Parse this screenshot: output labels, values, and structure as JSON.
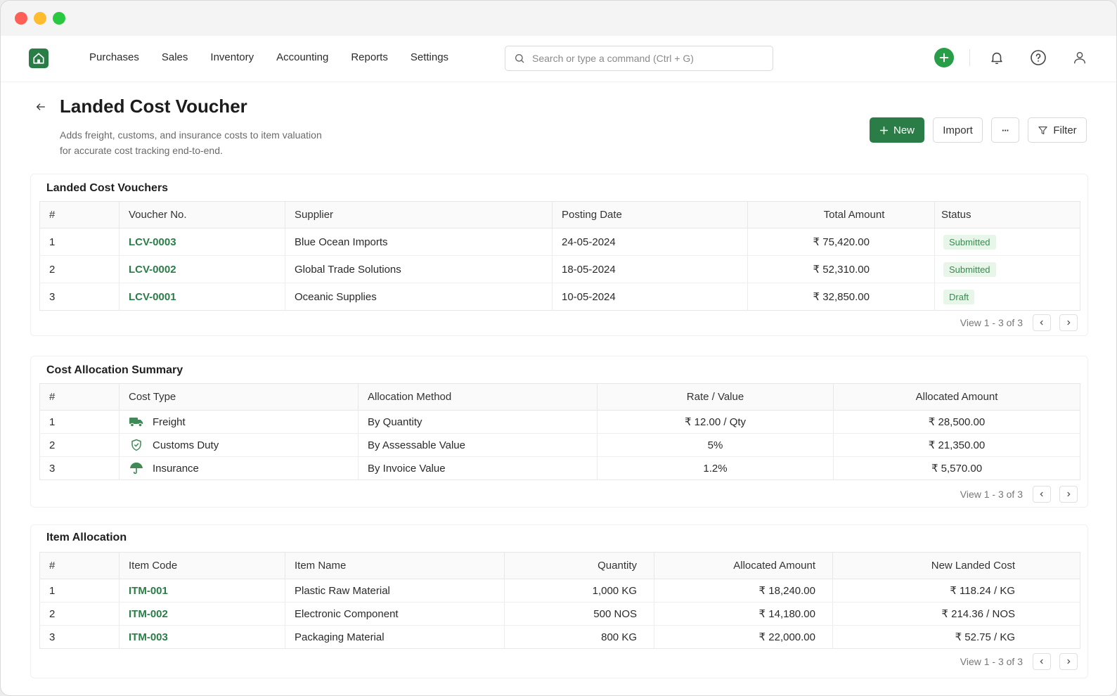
{
  "nav": {
    "items": [
      "Purchases",
      "Sales",
      "Inventory",
      "Accounting",
      "Reports",
      "Settings"
    ],
    "search_placeholder": "Search or type a command (Ctrl + G)"
  },
  "page": {
    "title": "Landed Cost Voucher",
    "subtitle_line1": "Adds freight, customs, and insurance costs to item valuation",
    "subtitle_line2": "for accurate cost tracking end-to-end.",
    "actions": {
      "new_label": "New",
      "import_label": "Import",
      "more_label": "···",
      "filter_label": "Filter"
    }
  },
  "vouchers": {
    "title": "Landed Cost Vouchers",
    "columns": [
      "#",
      "Voucher No.",
      "Supplier",
      "Posting Date",
      "Total Amount",
      "Status"
    ],
    "rows": [
      {
        "n": "1",
        "voucher": "LCV-0003",
        "supplier": "Blue Ocean Imports",
        "date": "24-05-2024",
        "amount": "₹ 75,420.00",
        "status": "Submitted"
      },
      {
        "n": "2",
        "voucher": "LCV-0002",
        "supplier": "Global Trade Solutions",
        "date": "18-05-2024",
        "amount": "₹ 52,310.00",
        "status": "Submitted"
      },
      {
        "n": "3",
        "voucher": "LCV-0001",
        "supplier": "Oceanic Supplies",
        "date": "10-05-2024",
        "amount": "₹ 32,850.00",
        "status": "Draft"
      }
    ],
    "pager": "View 1 - 3 of 3"
  },
  "costs": {
    "title": "Cost Allocation Summary",
    "columns": [
      "#",
      "Cost Type",
      "Allocation Method",
      "Rate / Value",
      "Allocated Amount"
    ],
    "rows": [
      {
        "n": "1",
        "icon": "truck-icon",
        "type": "Freight",
        "method": "By Quantity",
        "rate": "₹ 12.00 / Qty",
        "amount": "₹ 28,500.00"
      },
      {
        "n": "2",
        "icon": "shield-icon",
        "type": "Customs Duty",
        "method": "By Assessable Value",
        "rate": "5%",
        "amount": "₹ 21,350.00"
      },
      {
        "n": "3",
        "icon": "umbrella-icon",
        "type": "Insurance",
        "method": "By Invoice Value",
        "rate": "1.2%",
        "amount": "₹ 5,570.00"
      }
    ],
    "pager": "View 1 - 3 of 3"
  },
  "items": {
    "title": "Item Allocation",
    "columns": [
      "#",
      "Item Code",
      "Item Name",
      "Quantity",
      "Allocated Amount",
      "New Landed Cost"
    ],
    "rows": [
      {
        "n": "1",
        "code": "ITM-001",
        "name": "Plastic Raw Material",
        "qty": "1,000 KG",
        "amount": "₹ 18,240.00",
        "cost": "₹ 118.24 / KG"
      },
      {
        "n": "2",
        "code": "ITM-002",
        "name": "Electronic Component",
        "qty": "500 NOS",
        "amount": "₹ 14,180.00",
        "cost": "₹ 214.36 / NOS"
      },
      {
        "n": "3",
        "code": "ITM-003",
        "name": "Packaging Material",
        "qty": "800 KG",
        "amount": "₹ 22,000.00",
        "cost": "₹ 52.75 / KG"
      }
    ],
    "pager": "View 1 - 3 of 3"
  },
  "colors": {
    "accent": "#2a7d46",
    "badge_bg": "#e8f5e9",
    "badge_text": "#3b8a51"
  }
}
